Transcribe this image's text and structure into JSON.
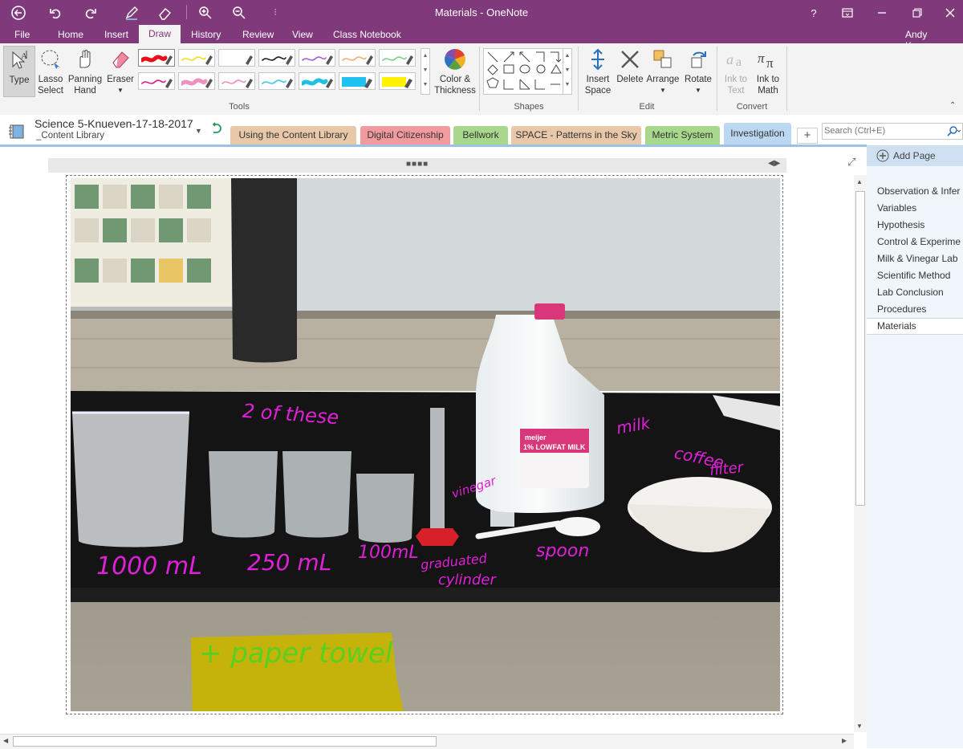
{
  "window": {
    "title": "Materials - OneNote",
    "help": "?"
  },
  "menu": {
    "file": "File",
    "tabs": [
      "Home",
      "Insert",
      "Draw",
      "History",
      "Review",
      "View",
      "Class Notebook"
    ],
    "user": "Andy Knueven"
  },
  "ribbon": {
    "type_label": "Type",
    "lasso_label1": "Lasso",
    "lasso_label2": "Select",
    "panning_label1": "Panning",
    "panning_label2": "Hand",
    "eraser_label": "Eraser",
    "color_label1": "Color &",
    "color_label2": "Thickness",
    "tools_group": "Tools",
    "shapes_group": "Shapes",
    "insert_space1": "Insert",
    "insert_space2": "Space",
    "delete_label": "Delete",
    "arrange_label": "Arrange",
    "rotate_label": "Rotate",
    "edit_group": "Edit",
    "ink_text1": "Ink to",
    "ink_text2": "Text",
    "ink_math1": "Ink to",
    "ink_math2": "Math",
    "convert_group": "Convert",
    "pen_colors": [
      "#e8101c",
      "#f2e020",
      "#ffffff",
      "#222222",
      "#a464d8",
      "#f0b070",
      "#7fd08a",
      "#e21d8e",
      "#f090c0",
      "#f090c0",
      "#40c8e8",
      "#20c0e0",
      "#20c0f0",
      "#fff200"
    ]
  },
  "notebook": {
    "name": "Science 5-Knueven-17-18-2017",
    "section_group": "_Content Library"
  },
  "sections": [
    {
      "label": "Using the Content Library",
      "color": "#e8c8a8"
    },
    {
      "label": "Digital Citizenship",
      "color": "#f29a9e"
    },
    {
      "label": "Bellwork",
      "color": "#a8d88c"
    },
    {
      "label": "SPACE - Patterns in the Sky",
      "color": "#e8c8a8"
    },
    {
      "label": "Metric System",
      "color": "#a8d88c"
    },
    {
      "label": "Investigation",
      "color": "#bcd8f0"
    }
  ],
  "add_section": "+",
  "search": {
    "placeholder": "Search (Ctrl+E)"
  },
  "pages": {
    "add_page": "Add Page",
    "items": [
      "Observation & Infer",
      "Variables",
      "Hypothesis",
      "Control & Experime",
      "Milk & Vinegar Lab",
      "Scientific Method",
      "Lab Conclusion",
      "Procedures",
      "Materials"
    ],
    "selected": "Materials"
  },
  "annotations": {
    "two_of_these": "2 of these",
    "ml_1000": "1000 mL",
    "ml_250": "250 mL",
    "ml_100": "100mL",
    "graduated": "graduated",
    "cylinder": "cylinder",
    "vinegar": "vinegar",
    "spoon": "spoon",
    "milk": "milk",
    "coffee": "coffee",
    "filter": "filter",
    "paper_towel": "+ paper towel"
  },
  "milk_label": {
    "brand": "meijer",
    "product": "1% LOWFAT MILK"
  },
  "icons": [
    "back-icon",
    "undo-icon",
    "redo-icon",
    "pen-icon",
    "eraser-icon",
    "zoom-in-icon",
    "zoom-out-icon",
    "customize-icon",
    "restore-icon",
    "minimize-icon",
    "maximize-icon",
    "close-icon"
  ]
}
